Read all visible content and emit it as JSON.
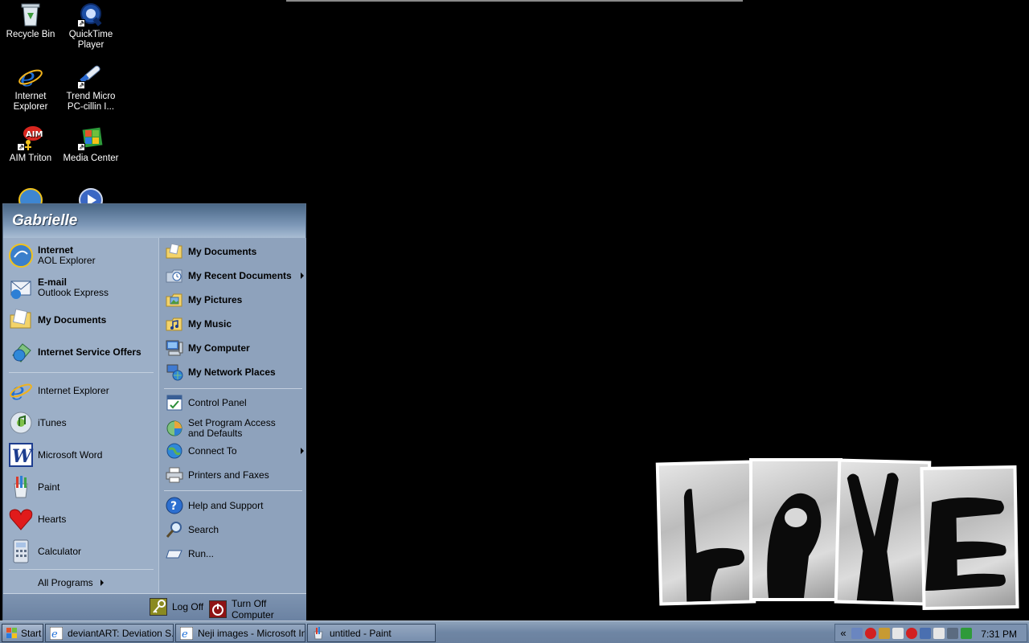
{
  "desktop": {
    "icons": [
      {
        "label": "Recycle Bin"
      },
      {
        "label": "QuickTime Player"
      },
      {
        "label": "Internet Explorer"
      },
      {
        "label": "Trend Micro PC-cillin I..."
      },
      {
        "label": "AIM Triton"
      },
      {
        "label": "Media Center"
      }
    ]
  },
  "start_menu": {
    "user_name": "Gabrielle",
    "pinned": [
      {
        "title": "Internet",
        "subtitle": "AOL Explorer"
      },
      {
        "title": "E-mail",
        "subtitle": "Outlook Express"
      },
      {
        "title": "My Documents",
        "subtitle": ""
      },
      {
        "title": "Internet Service Offers",
        "subtitle": ""
      }
    ],
    "recent": [
      {
        "label": "Internet Explorer"
      },
      {
        "label": "iTunes"
      },
      {
        "label": "Microsoft Word"
      },
      {
        "label": "Paint"
      },
      {
        "label": "Hearts"
      },
      {
        "label": "Calculator"
      }
    ],
    "all_programs": "All Programs",
    "places": [
      {
        "label": "My Documents"
      },
      {
        "label": "My Recent Documents"
      },
      {
        "label": "My Pictures"
      },
      {
        "label": "My Music"
      },
      {
        "label": "My Computer"
      },
      {
        "label": "My Network Places"
      }
    ],
    "settings": [
      {
        "label": "Control Panel"
      },
      {
        "label": "Set Program Access and Defaults"
      },
      {
        "label": "Connect To"
      },
      {
        "label": "Printers and Faxes"
      }
    ],
    "help": [
      {
        "label": "Help and Support"
      },
      {
        "label": "Search"
      },
      {
        "label": "Run..."
      }
    ],
    "log_off": "Log Off",
    "turn_off": "Turn Off Computer"
  },
  "taskbar": {
    "start_label": "Start",
    "tasks": [
      {
        "label": "deviantART: Deviation S..."
      },
      {
        "label": "Neji images - Microsoft Int..."
      },
      {
        "label": "untitled - Paint"
      }
    ],
    "tray_chevron": "«",
    "clock": "7:31 PM"
  },
  "colors": {
    "desktop_bg": "#000000",
    "menu_bg": "#96a9c2",
    "header_start": "#4a6786",
    "taskbar_bg": "#7c92b0"
  }
}
